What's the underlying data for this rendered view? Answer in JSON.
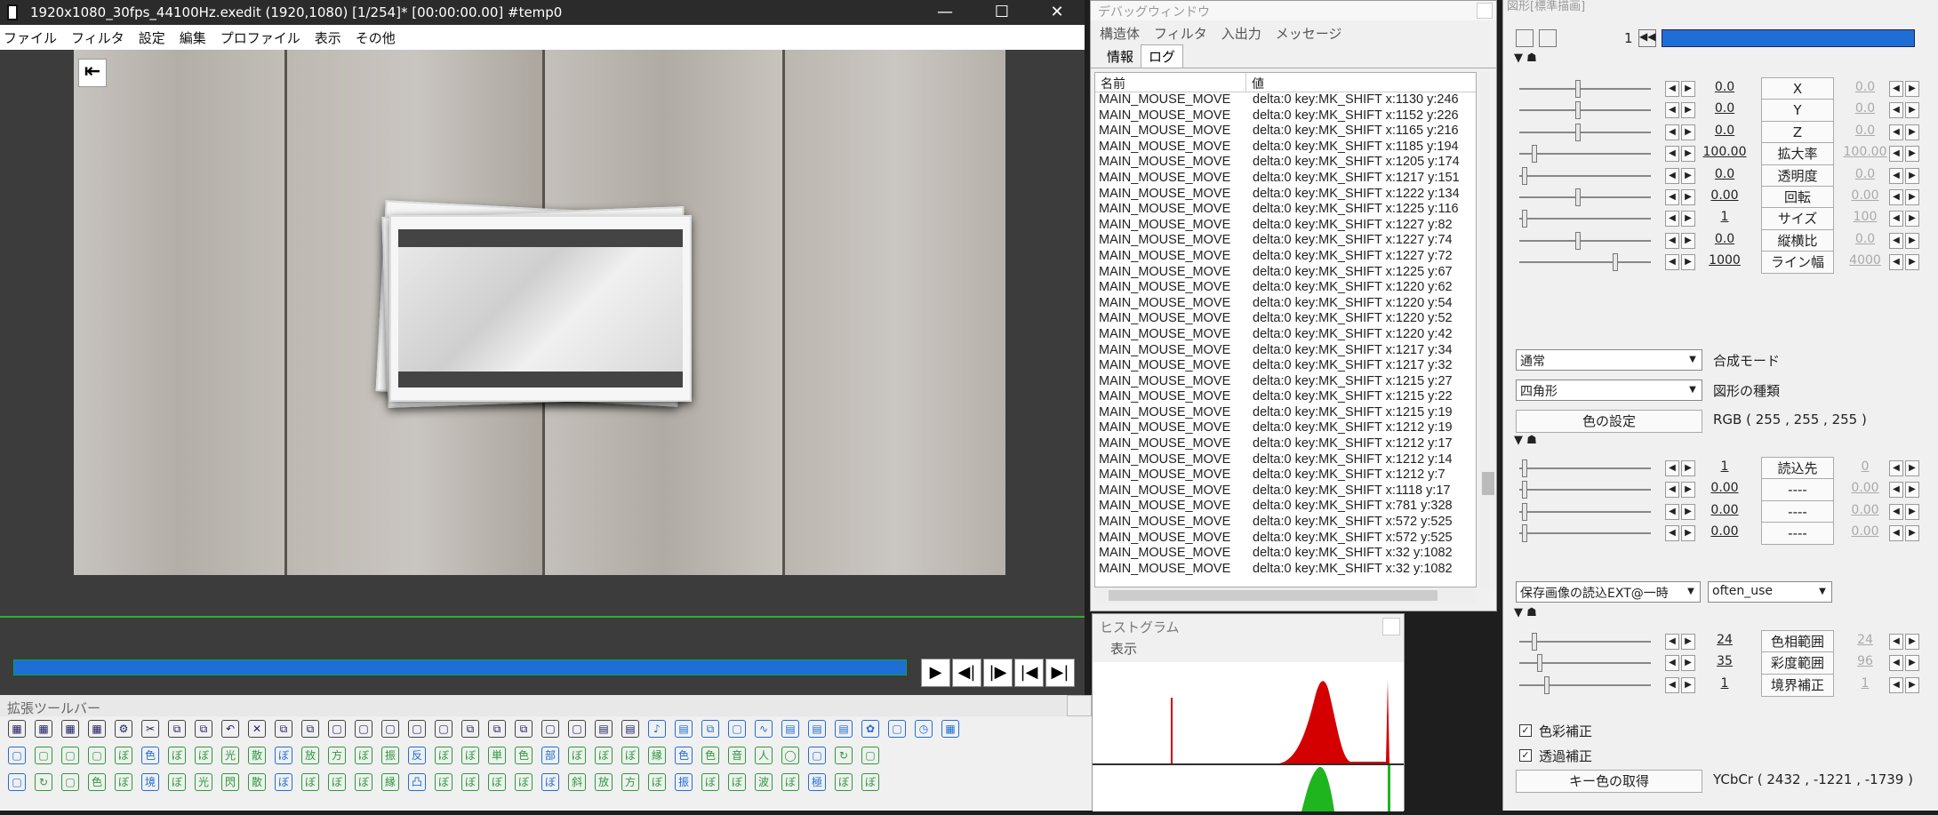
{
  "main_window": {
    "title": "1920x1080_30fps_44100Hz.exedit (1920,1080)  [1/254]* [00:00:00.00] #temp0",
    "minimize": "—",
    "maximize": "☐",
    "close": "✕",
    "menu": [
      "ファイル",
      "フィルタ",
      "設定",
      "編集",
      "プロファイル",
      "表示",
      "その他"
    ],
    "nav_icon": "⇤",
    "controls": [
      "▶",
      "◀|",
      "|▶",
      "|◀",
      "▶|"
    ]
  },
  "extended_toolbar": {
    "title": "拡張ツールバー",
    "row1": [
      "▦",
      "▦",
      "▦",
      "▦",
      "⚙",
      "✂",
      "⧉",
      "⧉",
      "↶",
      "✕",
      "⧉",
      "⧉",
      "▢",
      "▢",
      "▢",
      "▢",
      "▢",
      "⧉",
      "⧉",
      "⧉",
      "▢",
      "▢",
      "▤",
      "▤",
      "♪",
      "▤",
      "⧉",
      "▢",
      "∿",
      "▤",
      "▤",
      "▤",
      "✿",
      "▢",
      "◷",
      "▦"
    ],
    "row2": [
      "▢",
      "▢",
      "▢",
      "▢",
      "ぼ",
      "色",
      "ぼ",
      "ぼ",
      "光",
      "散",
      "ぼ",
      "放",
      "方",
      "ぼ",
      "振",
      "反",
      "ぼ",
      "ぼ",
      "単",
      "色",
      "部",
      "ぼ",
      "ぼ",
      "ぼ",
      "縁",
      "色",
      "色",
      "音",
      "人",
      "◯",
      "▢",
      "↻",
      "▢"
    ],
    "row3": [
      "▢",
      "↻",
      "▢",
      "色",
      "ぼ",
      "境",
      "ぼ",
      "光",
      "閃",
      "散",
      "ぼ",
      "ぼ",
      "ぼ",
      "ぼ",
      "縁",
      "凸",
      "ぼ",
      "ぼ",
      "ぼ",
      "ぼ",
      "ぼ",
      "斜",
      "放",
      "方",
      "ぼ",
      "振",
      "ぼ",
      "ぼ",
      "波",
      "ぼ",
      "極",
      "ぼ",
      "ぼ"
    ]
  },
  "debug_window": {
    "title": "デバッグウィンドウ",
    "tabs_top": [
      "構造体",
      "フィルタ",
      "入出力",
      "メッセージ"
    ],
    "tabs_bottom": [
      "情報",
      "ログ"
    ],
    "col_name": "名前",
    "col_value": "値",
    "rows": [
      {
        "name": "MAIN_MOUSE_MOVE",
        "value": "delta:0 key:MK_SHIFT x:1130 y:246"
      },
      {
        "name": "MAIN_MOUSE_MOVE",
        "value": "delta:0 key:MK_SHIFT x:1152 y:226"
      },
      {
        "name": "MAIN_MOUSE_MOVE",
        "value": "delta:0 key:MK_SHIFT x:1165 y:216"
      },
      {
        "name": "MAIN_MOUSE_MOVE",
        "value": "delta:0 key:MK_SHIFT x:1185 y:194"
      },
      {
        "name": "MAIN_MOUSE_MOVE",
        "value": "delta:0 key:MK_SHIFT x:1205 y:174"
      },
      {
        "name": "MAIN_MOUSE_MOVE",
        "value": "delta:0 key:MK_SHIFT x:1217 y:151"
      },
      {
        "name": "MAIN_MOUSE_MOVE",
        "value": "delta:0 key:MK_SHIFT x:1222 y:134"
      },
      {
        "name": "MAIN_MOUSE_MOVE",
        "value": "delta:0 key:MK_SHIFT x:1225 y:116"
      },
      {
        "name": "MAIN_MOUSE_MOVE",
        "value": "delta:0 key:MK_SHIFT x:1227 y:82"
      },
      {
        "name": "MAIN_MOUSE_MOVE",
        "value": "delta:0 key:MK_SHIFT x:1227 y:74"
      },
      {
        "name": "MAIN_MOUSE_MOVE",
        "value": "delta:0 key:MK_SHIFT x:1227 y:72"
      },
      {
        "name": "MAIN_MOUSE_MOVE",
        "value": "delta:0 key:MK_SHIFT x:1225 y:67"
      },
      {
        "name": "MAIN_MOUSE_MOVE",
        "value": "delta:0 key:MK_SHIFT x:1220 y:62"
      },
      {
        "name": "MAIN_MOUSE_MOVE",
        "value": "delta:0 key:MK_SHIFT x:1220 y:54"
      },
      {
        "name": "MAIN_MOUSE_MOVE",
        "value": "delta:0 key:MK_SHIFT x:1220 y:52"
      },
      {
        "name": "MAIN_MOUSE_MOVE",
        "value": "delta:0 key:MK_SHIFT x:1220 y:42"
      },
      {
        "name": "MAIN_MOUSE_MOVE",
        "value": "delta:0 key:MK_SHIFT x:1217 y:34"
      },
      {
        "name": "MAIN_MOUSE_MOVE",
        "value": "delta:0 key:MK_SHIFT x:1217 y:32"
      },
      {
        "name": "MAIN_MOUSE_MOVE",
        "value": "delta:0 key:MK_SHIFT x:1215 y:27"
      },
      {
        "name": "MAIN_MOUSE_MOVE",
        "value": "delta:0 key:MK_SHIFT x:1215 y:22"
      },
      {
        "name": "MAIN_MOUSE_MOVE",
        "value": "delta:0 key:MK_SHIFT x:1215 y:19"
      },
      {
        "name": "MAIN_MOUSE_MOVE",
        "value": "delta:0 key:MK_SHIFT x:1212 y:19"
      },
      {
        "name": "MAIN_MOUSE_MOVE",
        "value": "delta:0 key:MK_SHIFT x:1212 y:17"
      },
      {
        "name": "MAIN_MOUSE_MOVE",
        "value": "delta:0 key:MK_SHIFT x:1212 y:14"
      },
      {
        "name": "MAIN_MOUSE_MOVE",
        "value": "delta:0 key:MK_SHIFT x:1212 y:7"
      },
      {
        "name": "MAIN_MOUSE_MOVE",
        "value": "delta:0 key:MK_SHIFT x:1118 y:17"
      },
      {
        "name": "MAIN_MOUSE_MOVE",
        "value": "delta:0 key:MK_SHIFT x:781 y:328"
      },
      {
        "name": "MAIN_MOUSE_MOVE",
        "value": "delta:0 key:MK_SHIFT x:572 y:525"
      },
      {
        "name": "MAIN_MOUSE_MOVE",
        "value": "delta:0 key:MK_SHIFT x:572 y:525"
      },
      {
        "name": "MAIN_MOUSE_MOVE",
        "value": "delta:0 key:MK_SHIFT x:32 y:1082"
      },
      {
        "name": "MAIN_MOUSE_MOVE",
        "value": "delta:0 key:MK_SHIFT x:32 y:1082"
      }
    ]
  },
  "histogram": {
    "title": "ヒストグラム",
    "menu": "表示"
  },
  "object_panel": {
    "title": "図形[標準描画]",
    "frame_value": "1",
    "params": [
      {
        "left": "0.0",
        "label": "X",
        "right": "0.0",
        "knob_pct": 0.45
      },
      {
        "left": "0.0",
        "label": "Y",
        "right": "0.0",
        "knob_pct": 0.45
      },
      {
        "left": "0.0",
        "label": "Z",
        "right": "0.0",
        "knob_pct": 0.45
      },
      {
        "left": "100.00",
        "label": "拡大率",
        "right": "100.00",
        "knob_pct": 0.1
      },
      {
        "left": "0.0",
        "label": "透明度",
        "right": "0.0",
        "knob_pct": 0.02
      },
      {
        "left": "0.00",
        "label": "回転",
        "right": "0.00",
        "knob_pct": 0.45
      },
      {
        "left": "1",
        "label": "サイズ",
        "right": "100",
        "knob_pct": 0.02
      },
      {
        "left": "0.0",
        "label": "縦横比",
        "right": "0.0",
        "knob_pct": 0.45
      },
      {
        "left": "1000",
        "label": "ライン幅",
        "right": "4000",
        "knob_pct": 0.75
      }
    ],
    "blend_mode_value": "通常",
    "blend_mode_label": "合成モード",
    "shape_value": "四角形",
    "shape_label": "図形の種類",
    "color_button": "色の設定",
    "color_value": "RGB ( 255 , 255 , 255 )",
    "params2": [
      {
        "left": "1",
        "label": "読込先",
        "right": "0",
        "knob_pct": 0.02
      },
      {
        "left": "0.00",
        "label": "----",
        "right": "0.00",
        "knob_pct": 0.02
      },
      {
        "left": "0.00",
        "label": "----",
        "right": "0.00",
        "knob_pct": 0.02
      },
      {
        "left": "0.00",
        "label": "----",
        "right": "0.00",
        "knob_pct": 0.02
      }
    ],
    "script_select": "保存画像の読込EXT@一時",
    "script_select2": "often_use",
    "params3": [
      {
        "left": "24",
        "label": "色相範囲",
        "right": "24",
        "knob_pct": 0.1
      },
      {
        "left": "35",
        "label": "彩度範囲",
        "right": "96",
        "knob_pct": 0.14
      },
      {
        "left": "1",
        "label": "境界補正",
        "right": "1",
        "knob_pct": 0.2
      }
    ],
    "check1": "色彩補正",
    "check2": "透過補正",
    "key_button": "キー色の取得",
    "ycbcr_value": "YCbCr ( 2432 , -1221 , -1739 )"
  }
}
